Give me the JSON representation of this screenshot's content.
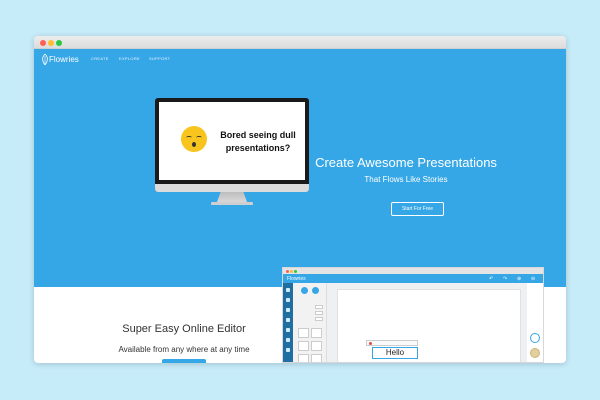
{
  "brand": {
    "name": "Flowries"
  },
  "nav": {
    "items": [
      {
        "label": "CREATE"
      },
      {
        "label": "EXPLORE"
      },
      {
        "label": "SUPPORT"
      }
    ]
  },
  "hero": {
    "screen_text": "Bored seeing dull presentations?",
    "title": "Create Awesome Presentations",
    "subtitle": "That Flows Like Stories",
    "cta_label": "Start For Free"
  },
  "editor_section": {
    "title": "Super Easy Online Editor",
    "subtitle": "Available from any where at any time"
  },
  "mini_editor": {
    "logo": "Flowries",
    "canvas_text": "Hello"
  },
  "colors": {
    "brand_blue": "#35a6e6",
    "page_bg": "#c6ebf9",
    "emoji_yellow": "#f7c51d"
  },
  "icons": [
    "logo-leaf-icon",
    "emoji-face-icon",
    "undo-icon",
    "redo-icon",
    "zoom-in-icon",
    "zoom-out-icon",
    "add-icon"
  ]
}
